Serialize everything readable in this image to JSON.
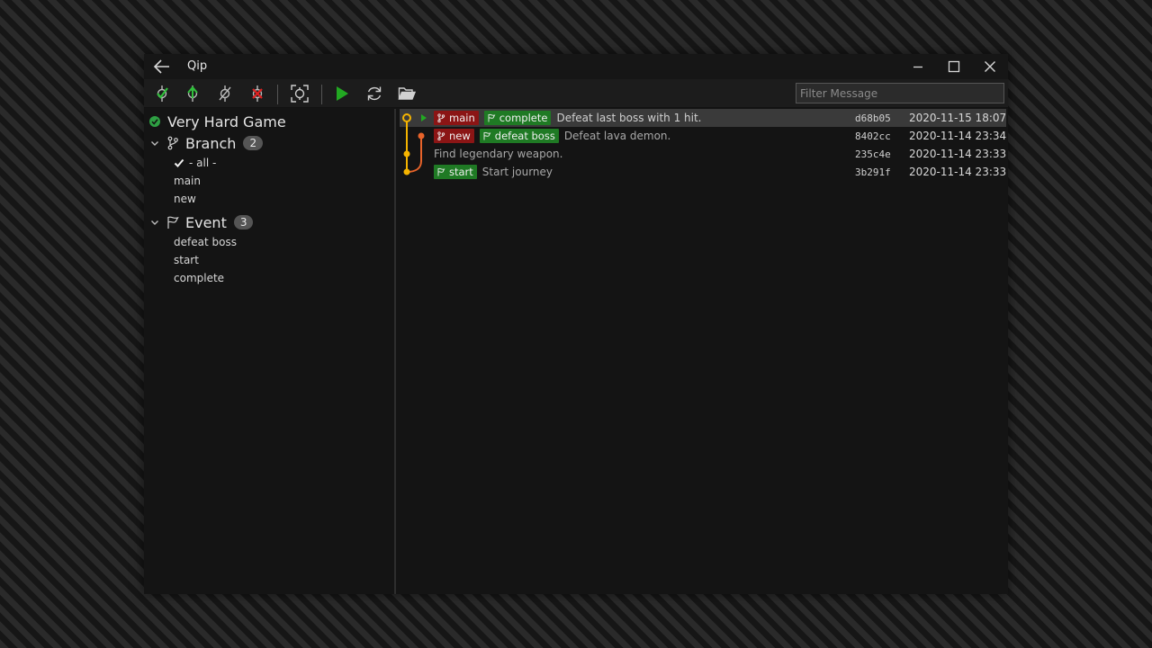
{
  "window": {
    "title": "Qip"
  },
  "toolbar": {
    "filter_placeholder": "Filter Message",
    "tools": [
      "commit-icon",
      "push-icon",
      "unlink-icon",
      "discard-icon",
      "screenshot-icon",
      "play-icon",
      "refresh-icon",
      "folder-open-icon"
    ]
  },
  "sidebar": {
    "repo": {
      "name": "Very Hard Game",
      "status_color": "#2ea043"
    },
    "branch_section": {
      "label": "Branch",
      "count": "2",
      "items": [
        {
          "label": "- all -",
          "checked": true
        },
        {
          "label": "main"
        },
        {
          "label": "new"
        }
      ]
    },
    "event_section": {
      "label": "Event",
      "count": "3",
      "items": [
        {
          "label": "defeat boss"
        },
        {
          "label": "start"
        },
        {
          "label": "complete"
        }
      ]
    }
  },
  "commits": [
    {
      "branch": "main",
      "event": "complete",
      "message": "Defeat last boss with 1 hit.",
      "hash": "d68b05",
      "date": "2020-11-15 18:07",
      "selected": true
    },
    {
      "branch": "new",
      "event": "defeat boss",
      "message": "Defeat lava demon.",
      "hash": "8402cc",
      "date": "2020-11-14 23:34"
    },
    {
      "message": "Find legendary weapon.",
      "hash": "235c4e",
      "date": "2020-11-14 23:33"
    },
    {
      "event": "start",
      "message": "Start journey",
      "hash": "3b291f",
      "date": "2020-11-14 23:33"
    }
  ],
  "colors": {
    "accent_green": "#1f7a24",
    "branch_red": "#8b1515",
    "graph_main": "#f5b400",
    "graph_new": "#e8632a",
    "play_green": "#22a822"
  }
}
